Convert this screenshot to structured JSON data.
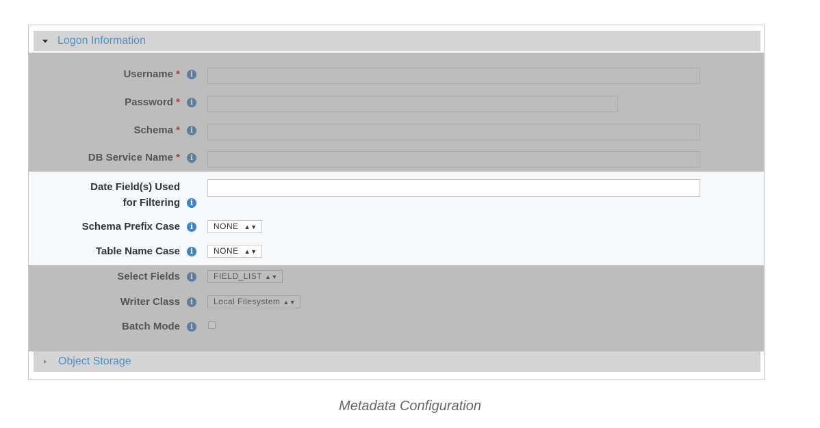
{
  "sections": {
    "logon": {
      "title": "Logon Information",
      "expanded": true
    },
    "object_storage": {
      "title": "Object Storage",
      "expanded": false
    }
  },
  "required_marker": "*",
  "info_glyph": "i",
  "fields": {
    "username": {
      "label": "Username",
      "required": true,
      "value": "",
      "disabled": true
    },
    "password": {
      "label": "Password",
      "required": true,
      "value": "",
      "disabled": true
    },
    "schema": {
      "label": "Schema",
      "required": true,
      "value": "",
      "disabled": true
    },
    "db_service_name": {
      "label": "DB Service Name",
      "required": true,
      "value": "",
      "disabled": true
    },
    "date_fields": {
      "label_line1": "Date Field(s) Used",
      "label_line2": "for Filtering",
      "value": ""
    },
    "schema_prefix_case": {
      "label": "Schema Prefix Case",
      "value": "NONE"
    },
    "table_name_case": {
      "label": "Table Name Case",
      "value": "NONE"
    },
    "select_fields": {
      "label": "Select Fields",
      "value": "FIELD_LIST",
      "disabled": true
    },
    "writer_class": {
      "label": "Writer Class",
      "value": "Local Filesystem",
      "disabled": true
    },
    "batch_mode": {
      "label": "Batch Mode",
      "checked": false,
      "disabled": true
    }
  },
  "caption": "Metadata Configuration",
  "colors": {
    "accent": "#4a90c4",
    "required": "#c0392b",
    "info_icon": "#3a86c8",
    "disabled_overlay": "#bdbdbd"
  }
}
